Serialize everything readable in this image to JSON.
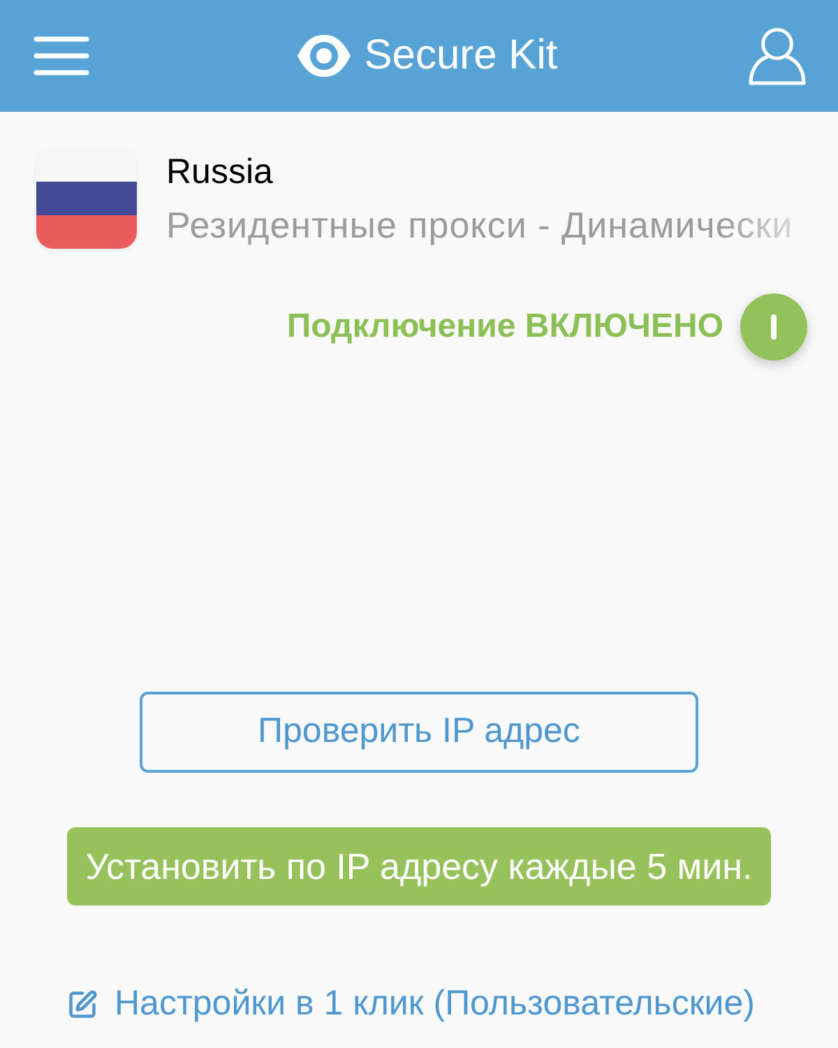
{
  "header": {
    "title": "Secure Kit"
  },
  "location": {
    "country": "Russia",
    "subtitle": "Резидентные прокси - Динамически"
  },
  "connection": {
    "label": "Подключение ВКЛЮЧЕНО",
    "on": true
  },
  "buttons": [
    {
      "label": "Проверить IP адрес",
      "kind": "outline"
    },
    {
      "label": "Установить по IP адресу каждые 5 мин.",
      "kind": "filled"
    }
  ],
  "settings_link": {
    "label": "Настройки в 1 клик (Пользовательские)"
  }
}
